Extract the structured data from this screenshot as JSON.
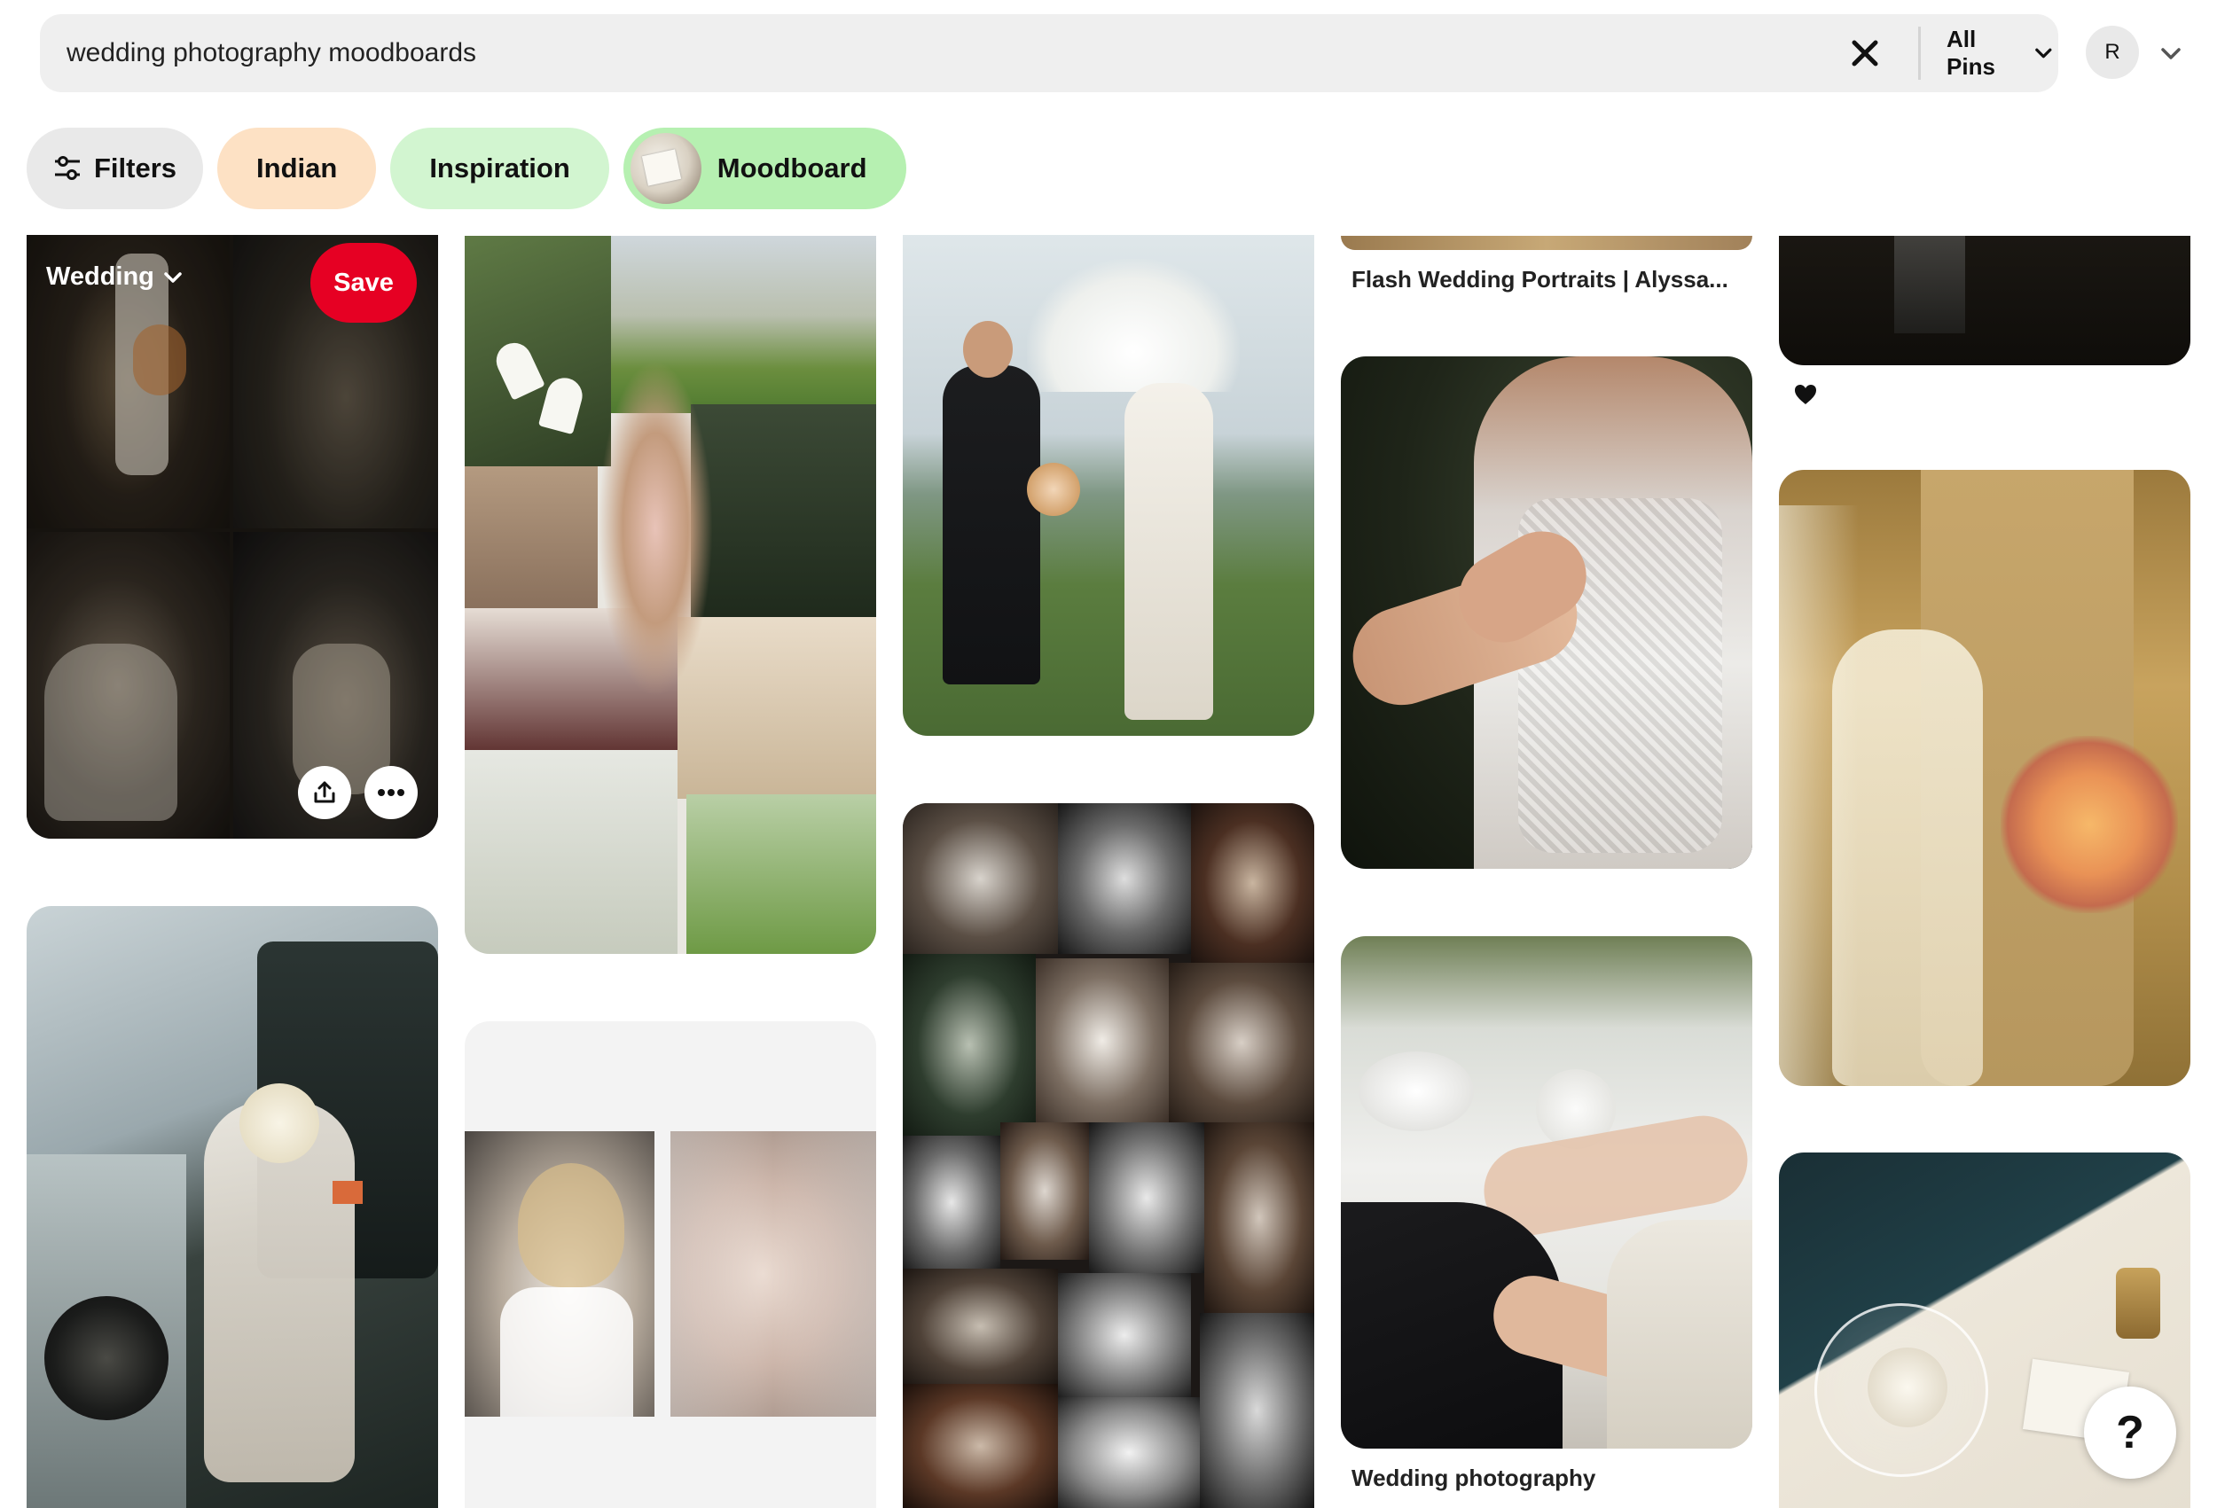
{
  "search": {
    "value": "wedding photography moodboards",
    "clear_icon": "close-icon",
    "scope_label": "All Pins"
  },
  "account": {
    "initial": "R"
  },
  "chips": [
    {
      "label": "Filters",
      "icon": "filters-icon",
      "color": "#e9e9e9"
    },
    {
      "label": "Indian",
      "color": "#fde1c4"
    },
    {
      "label": "Inspiration",
      "color": "#d2f5d0"
    },
    {
      "label": "Moodboard",
      "color": "#b6f0b1"
    }
  ],
  "hover_pin": {
    "board_label": "Wedding",
    "save_label": "Save",
    "share_icon": "share-icon",
    "more_icon": "more-icon"
  },
  "pin_titles": {
    "flash_portraits": "Flash Wedding Portraits | Alyssa...",
    "wedding_photography": "Wedding photography"
  },
  "reaction_icon": "heart-icon",
  "help": {
    "label": "?"
  },
  "colors": {
    "save_red": "#e60023",
    "search_bg": "#efefef"
  }
}
